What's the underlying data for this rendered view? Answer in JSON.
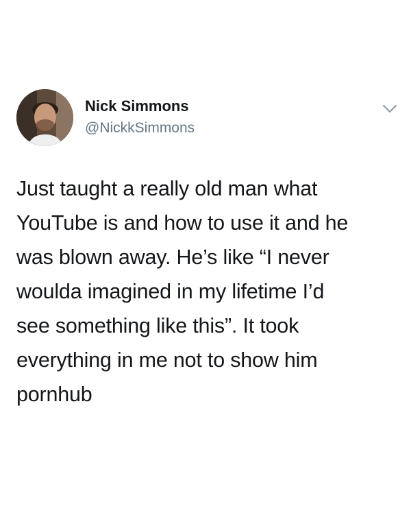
{
  "tweet": {
    "author": {
      "display_name": "Nick Simmons",
      "handle": "@NickkSimmons"
    },
    "menu_icon": "chevron-down-icon",
    "avatar_icon": "profile-photo",
    "text": "Just taught a really old man what\nYouTube is and how to use it and he\nwas blown away. He’s like “I never\nwoulda imagined in my lifetime I’d\nsee something like this”. It took\neverything in me not to show him\npornhub"
  },
  "colors": {
    "text_primary": "#14171a",
    "text_secondary": "#657786",
    "background": "#ffffff"
  }
}
